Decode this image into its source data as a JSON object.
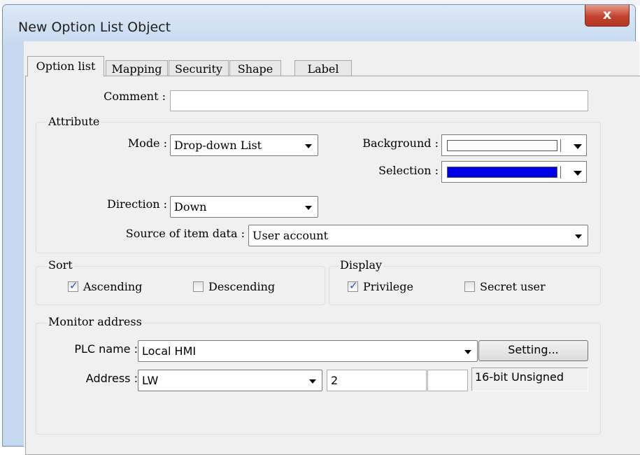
{
  "window": {
    "title": "New  Option List Object",
    "close_glyph": "x"
  },
  "tabs": [
    {
      "label": "Option list",
      "active": true
    },
    {
      "label": "Mapping"
    },
    {
      "label": "Security"
    },
    {
      "label": "Shape"
    },
    {
      "label": "Label"
    }
  ],
  "comment": {
    "label": "Comment :",
    "value": ""
  },
  "attribute": {
    "legend": "Attribute",
    "mode": {
      "label": "Mode :",
      "value": "Drop-down List"
    },
    "direction": {
      "label": "Direction :",
      "value": "Down"
    },
    "source": {
      "label": "Source of item data :",
      "value": "User account"
    },
    "background": {
      "label": "Background :",
      "color": "#ffffff"
    },
    "selection": {
      "label": "Selection :",
      "color": "#0000e6"
    }
  },
  "sort": {
    "legend": "Sort",
    "ascending": {
      "label": "Ascending",
      "checked": true
    },
    "descending": {
      "label": "Descending",
      "checked": false
    }
  },
  "display": {
    "legend": "Display",
    "privilege": {
      "label": "Privilege",
      "checked": true
    },
    "secret_user": {
      "label": "Secret user",
      "checked": false
    }
  },
  "monitor": {
    "legend": "Monitor address",
    "plc_name": {
      "label": "PLC name :",
      "value": "Local HMI"
    },
    "setting_button": "Setting...",
    "address": {
      "label": "Address :",
      "device": "LW",
      "index": "2",
      "extra": "",
      "data_format": "16-bit Unsigned"
    }
  }
}
